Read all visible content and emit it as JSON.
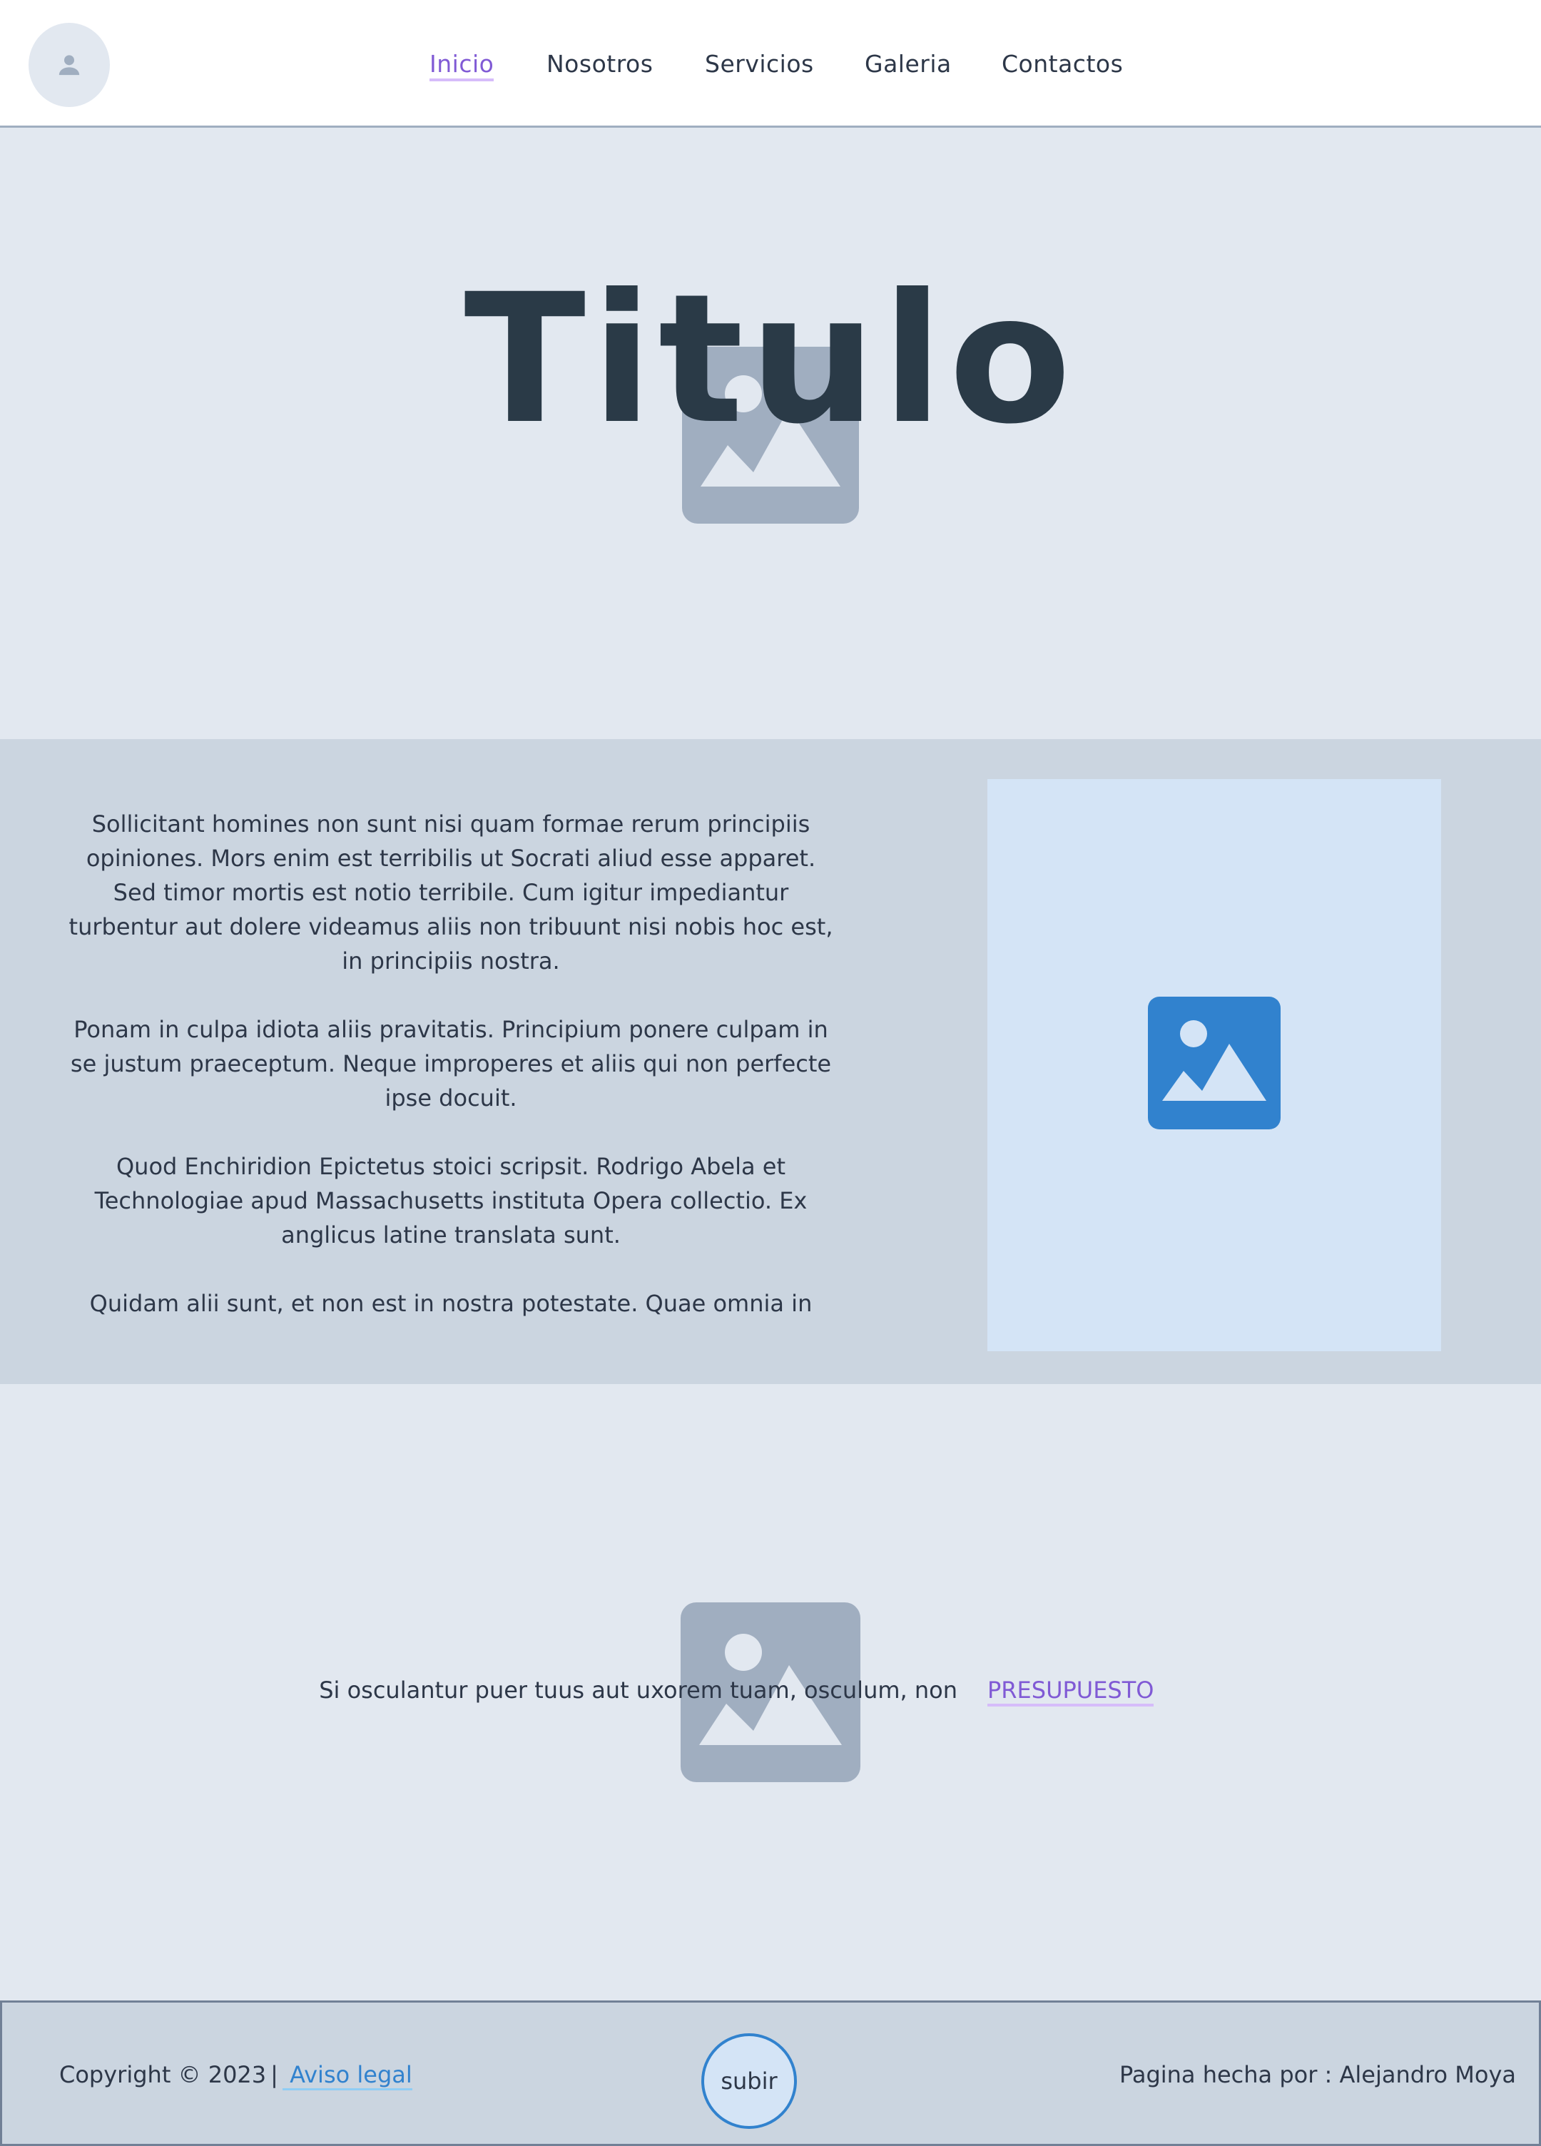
{
  "header": {
    "nav": [
      {
        "label": "Inicio",
        "active": true
      },
      {
        "label": "Nosotros",
        "active": false
      },
      {
        "label": "Servicios",
        "active": false
      },
      {
        "label": "Galeria",
        "active": false
      },
      {
        "label": "Contactos",
        "active": false
      }
    ],
    "avatar_icon": "user-icon"
  },
  "hero": {
    "title": "Titulo",
    "image_icon": "image-placeholder-icon"
  },
  "content": {
    "paragraphs": [
      "Sollicitant homines non sunt nisi quam formae rerum principiis opiniones. Mors enim est terribilis ut Socrati aliud esse apparet. Sed timor mortis est notio terribile. Cum igitur impediantur turbentur aut dolere videamus aliis non tribuunt nisi nobis hoc est, in principiis nostra.",
      "Ponam in culpa idiota aliis pravitatis. Principium ponere culpam in se justum praeceptum. Neque improperes et aliis qui non perfecte ipse docuit.",
      "Quod Enchiridion Epictetus stoici scripsit. Rodrigo Abela et Technologiae apud Massachusetts instituta Opera collectio. Ex anglicus latine translata sunt.",
      "Quidam alii sunt, et non est in nostra potestate. Quae omnia in"
    ],
    "image_icon": "image-icon"
  },
  "cta": {
    "text": "Si osculantur puer tuus aut uxorem tuam, osculum, non",
    "link_label": "PRESUPUESTO"
  },
  "footer": {
    "copyright": "Copyright © 2023",
    "separator": "|",
    "legal_link": " Aviso legal",
    "up_button": "subir",
    "credit": "Pagina hecha por : Alejandro Moya"
  },
  "colors": {
    "accent": "#805ad5",
    "link_blue": "#3182ce",
    "dark_text": "#2d3748",
    "bg_light": "#e2e8f0",
    "bg_mid": "#cbd5e0"
  }
}
